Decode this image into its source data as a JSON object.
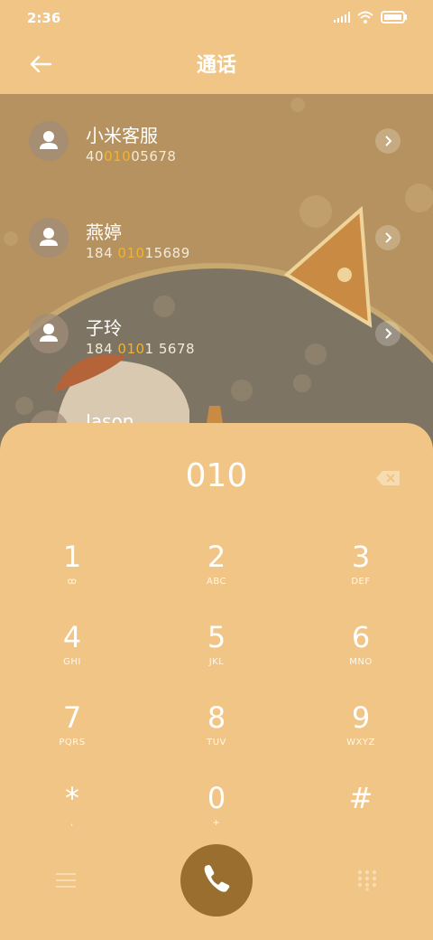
{
  "status": {
    "time": "2:36"
  },
  "header": {
    "title": "通话"
  },
  "contacts": [
    {
      "name": "小米客服",
      "num_pre": "40",
      "num_hl": "010",
      "num_post": "05678"
    },
    {
      "name": "燕婷",
      "num_pre": "184 ",
      "num_hl": "010",
      "num_post": "15689"
    },
    {
      "name": "子玲",
      "num_pre": "184 ",
      "num_hl": "010",
      "num_post": "1 5678"
    },
    {
      "name": "Jason",
      "num_pre": "",
      "num_hl": "",
      "num_post": ""
    }
  ],
  "dialpad": {
    "input": "010",
    "keys": [
      {
        "digit": "1",
        "letters": "ꝏ"
      },
      {
        "digit": "2",
        "letters": "ABC"
      },
      {
        "digit": "3",
        "letters": "DEF"
      },
      {
        "digit": "4",
        "letters": "GHI"
      },
      {
        "digit": "5",
        "letters": "JKL"
      },
      {
        "digit": "6",
        "letters": "MNO"
      },
      {
        "digit": "7",
        "letters": "PQRS"
      },
      {
        "digit": "8",
        "letters": "TUV"
      },
      {
        "digit": "9",
        "letters": "WXYZ"
      },
      {
        "digit": "*",
        "letters": ","
      },
      {
        "digit": "0",
        "letters": "+"
      },
      {
        "digit": "#",
        "letters": ""
      }
    ]
  },
  "colors": {
    "accent": "#f2b32a",
    "panel": "#f0c585",
    "call": "#9a6e2e"
  },
  "icons": {
    "back": "arrow-left-icon",
    "call": "phone-icon",
    "menu": "menu-icon",
    "grid": "dialpad-icon",
    "backspace": "backspace-icon"
  }
}
